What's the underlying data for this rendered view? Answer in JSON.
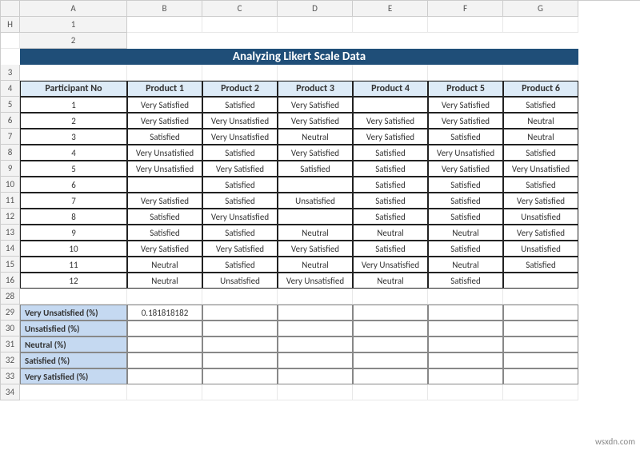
{
  "columns": [
    "A",
    "B",
    "C",
    "D",
    "E",
    "F",
    "G",
    "H"
  ],
  "rows_top": [
    "1",
    "2",
    "3",
    "4",
    "5",
    "6",
    "7",
    "8",
    "9",
    "10",
    "11",
    "12",
    "13",
    "14",
    "15",
    "16"
  ],
  "rows_bottom": [
    "28",
    "29",
    "30",
    "31",
    "32",
    "33",
    "34"
  ],
  "title": "Analyzing Likert Scale Data",
  "headers": [
    "Participant No",
    "Product 1",
    "Product 2",
    "Product 3",
    "Product 4",
    "Product 5",
    "Product 6"
  ],
  "data": [
    [
      "1",
      "Very Satisfied",
      "Satisfied",
      "Very Satisfied",
      "",
      "Very Satisfied",
      "Satisfied"
    ],
    [
      "2",
      "Very Satisfied",
      "Very Unsatisfied",
      "Very Satisfied",
      "Very Satisfied",
      "Very Satisfied",
      "Neutral"
    ],
    [
      "3",
      "Satisfied",
      "Very Unsatisfied",
      "Neutral",
      "Very Satisfied",
      "Satisfied",
      "Neutral"
    ],
    [
      "4",
      "Very Unsatisfied",
      "Satisfied",
      "Very Satisfied",
      "Satisfied",
      "Very Unsatisfied",
      "Satisfied"
    ],
    [
      "5",
      "Very Unsatisfied",
      "Very Satisfied",
      "Satisfied",
      "Satisfied",
      "Very Satisfied",
      "Very Unsatisfied"
    ],
    [
      "6",
      "",
      "Satisfied",
      "",
      "Satisfied",
      "Satisfied",
      "Satisfied"
    ],
    [
      "7",
      "Very Satisfied",
      "Satisfied",
      "Unsatisfied",
      "Satisfied",
      "Satisfied",
      "Very Satisfied"
    ],
    [
      "8",
      "Satisfied",
      "Very Unsatisfied",
      "",
      "Satisfied",
      "Satisfied",
      "Unsatisfied"
    ],
    [
      "9",
      "Satisfied",
      "Satisfied",
      "Neutral",
      "Neutral",
      "Neutral",
      "Very Satisfied"
    ],
    [
      "10",
      "Very Satisfied",
      "Very Satisfied",
      "Very Satisfied",
      "Satisfied",
      "Satisfied",
      "Unsatisfied"
    ],
    [
      "11",
      "Neutral",
      "Satisfied",
      "Neutral",
      "Very Unsatisfied",
      "Neutral",
      "Satisfied"
    ],
    [
      "12",
      "Neutral",
      "Unsatisfied",
      "Very Unsatisfied",
      "Neutral",
      "Satisfied",
      ""
    ]
  ],
  "pct_labels": [
    "Very Unsatisfied (%)",
    "Unsatisfied (%)",
    "Neutral (%)",
    "Satisfied (%)",
    "Very Satisfied (%)"
  ],
  "pct_values": [
    [
      "0.181818182",
      "",
      "",
      "",
      "",
      ""
    ],
    [
      "",
      "",
      "",
      "",
      "",
      ""
    ],
    [
      "",
      "",
      "",
      "",
      "",
      ""
    ],
    [
      "",
      "",
      "",
      "",
      "",
      ""
    ],
    [
      "",
      "",
      "",
      "",
      "",
      ""
    ]
  ],
  "watermark": "wsxdn.com"
}
